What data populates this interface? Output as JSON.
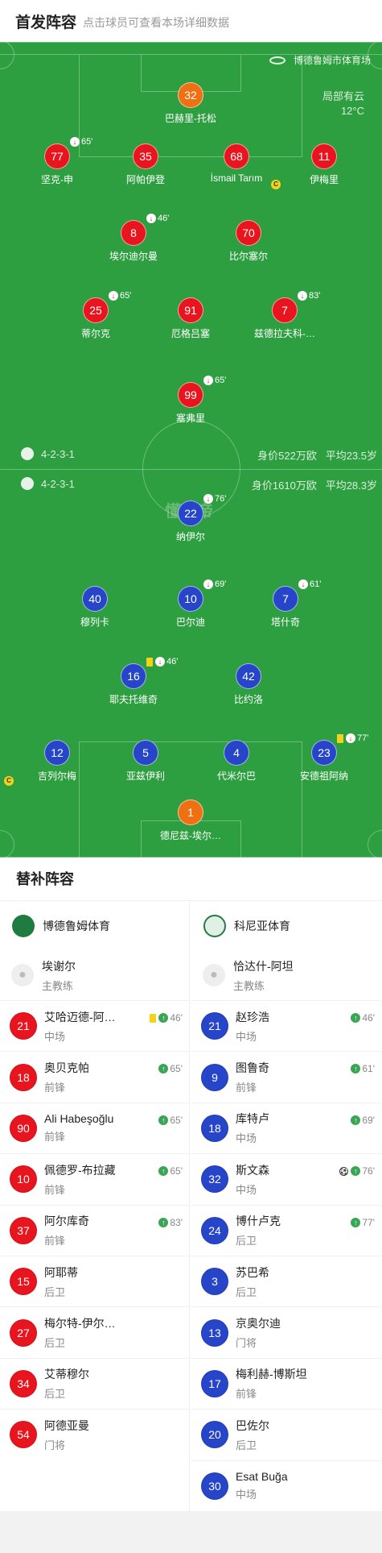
{
  "header": {
    "title": "首发阵容",
    "subtitle": "点击球员可查看本场详细数据"
  },
  "venue": "博德鲁姆市体育场",
  "weather": {
    "desc": "局部有云",
    "temp": "12°C"
  },
  "watermark": "懂球帝",
  "home": {
    "formation": "4-2-3-1",
    "value": "身价522万欧",
    "age": "平均23.5岁"
  },
  "away": {
    "formation": "4-2-3-1",
    "value": "身价1610万欧",
    "age": "平均28.3岁"
  },
  "home_players": [
    {
      "num": "32",
      "name": "巴赫里-托松",
      "color": "#ef6f13"
    },
    {
      "num": "77",
      "name": "坚克-申",
      "sub": "65'"
    },
    {
      "num": "35",
      "name": "阿帕伊登"
    },
    {
      "num": "68",
      "name": "İsmail Tarım"
    },
    {
      "num": "11",
      "name": "伊梅里",
      "cap": "C"
    },
    {
      "num": "8",
      "name": "埃尔迪尔曼",
      "sub": "46'"
    },
    {
      "num": "70",
      "name": "比尔塞尔",
      "goal": true
    },
    {
      "num": "25",
      "name": "蒂尔克",
      "sub": "65'"
    },
    {
      "num": "91",
      "name": "厄格吕塞"
    },
    {
      "num": "7",
      "name": "兹德拉夫科-…",
      "sub": "83'"
    },
    {
      "num": "99",
      "name": "塞弗里",
      "sub": "65'"
    }
  ],
  "away_players": [
    {
      "num": "22",
      "name": "纳伊尔",
      "sub": "76'",
      "goal": true
    },
    {
      "num": "40",
      "name": "穆列卡"
    },
    {
      "num": "10",
      "name": "巴尔迪",
      "sub": "69'"
    },
    {
      "num": "7",
      "name": "塔什奇",
      "sub": "61'"
    },
    {
      "num": "16",
      "name": "耶夫托维奇",
      "sub": "46'",
      "yellow": true
    },
    {
      "num": "42",
      "name": "比约洛",
      "goal": true
    },
    {
      "num": "12",
      "name": "吉列尔梅",
      "cap": "C"
    },
    {
      "num": "5",
      "name": "亚兹伊利"
    },
    {
      "num": "4",
      "name": "代米尔巴"
    },
    {
      "num": "23",
      "name": "安德祖阿纳",
      "sub": "77'",
      "yellow": true
    },
    {
      "num": "1",
      "name": "德尼兹-埃尔…",
      "color": "#ef6f13"
    }
  ],
  "subs": {
    "title": "替补阵容",
    "home": {
      "team": "博德鲁姆体育",
      "coach": "埃谢尔",
      "coach_role": "主教练",
      "players": [
        {
          "num": "21",
          "name": "艾哈迈德-阿…",
          "pos": "中场",
          "min": "46'",
          "yellow": true
        },
        {
          "num": "18",
          "name": "奥贝克帕",
          "pos": "前锋",
          "min": "65'"
        },
        {
          "num": "90",
          "name": "Ali Habeşoğlu",
          "pos": "前锋",
          "min": "65'"
        },
        {
          "num": "10",
          "name": "佩德罗-布拉藏",
          "pos": "前锋",
          "min": "65'"
        },
        {
          "num": "37",
          "name": "阿尔库奇",
          "pos": "前锋",
          "min": "83'"
        },
        {
          "num": "15",
          "name": "阿耶蒂",
          "pos": "后卫"
        },
        {
          "num": "27",
          "name": "梅尔特-伊尔…",
          "pos": "后卫"
        },
        {
          "num": "34",
          "name": "艾蒂穆尔",
          "pos": "后卫"
        },
        {
          "num": "54",
          "name": "阿德亚曼",
          "pos": "门将"
        }
      ]
    },
    "away": {
      "team": "科尼亚体育",
      "coach": "恰达什-阿坦",
      "coach_role": "主教练",
      "players": [
        {
          "num": "21",
          "name": "赵珍浩",
          "pos": "中场",
          "min": "46'"
        },
        {
          "num": "9",
          "name": "图鲁奇",
          "pos": "前锋",
          "min": "61'"
        },
        {
          "num": "18",
          "name": "库特卢",
          "pos": "中场",
          "min": "69'"
        },
        {
          "num": "32",
          "name": "斯文森",
          "pos": "中场",
          "min": "76'",
          "goal": true
        },
        {
          "num": "24",
          "name": "博什卢克",
          "pos": "后卫",
          "min": "77'"
        },
        {
          "num": "3",
          "name": "苏巴希",
          "pos": "后卫"
        },
        {
          "num": "13",
          "name": "京奥尔迪",
          "pos": "门将"
        },
        {
          "num": "17",
          "name": "梅利赫-博斯坦",
          "pos": "前锋"
        },
        {
          "num": "20",
          "name": "巴佐尔",
          "pos": "后卫"
        },
        {
          "num": "30",
          "name": "Esat Buğa",
          "pos": "中场"
        }
      ]
    }
  }
}
